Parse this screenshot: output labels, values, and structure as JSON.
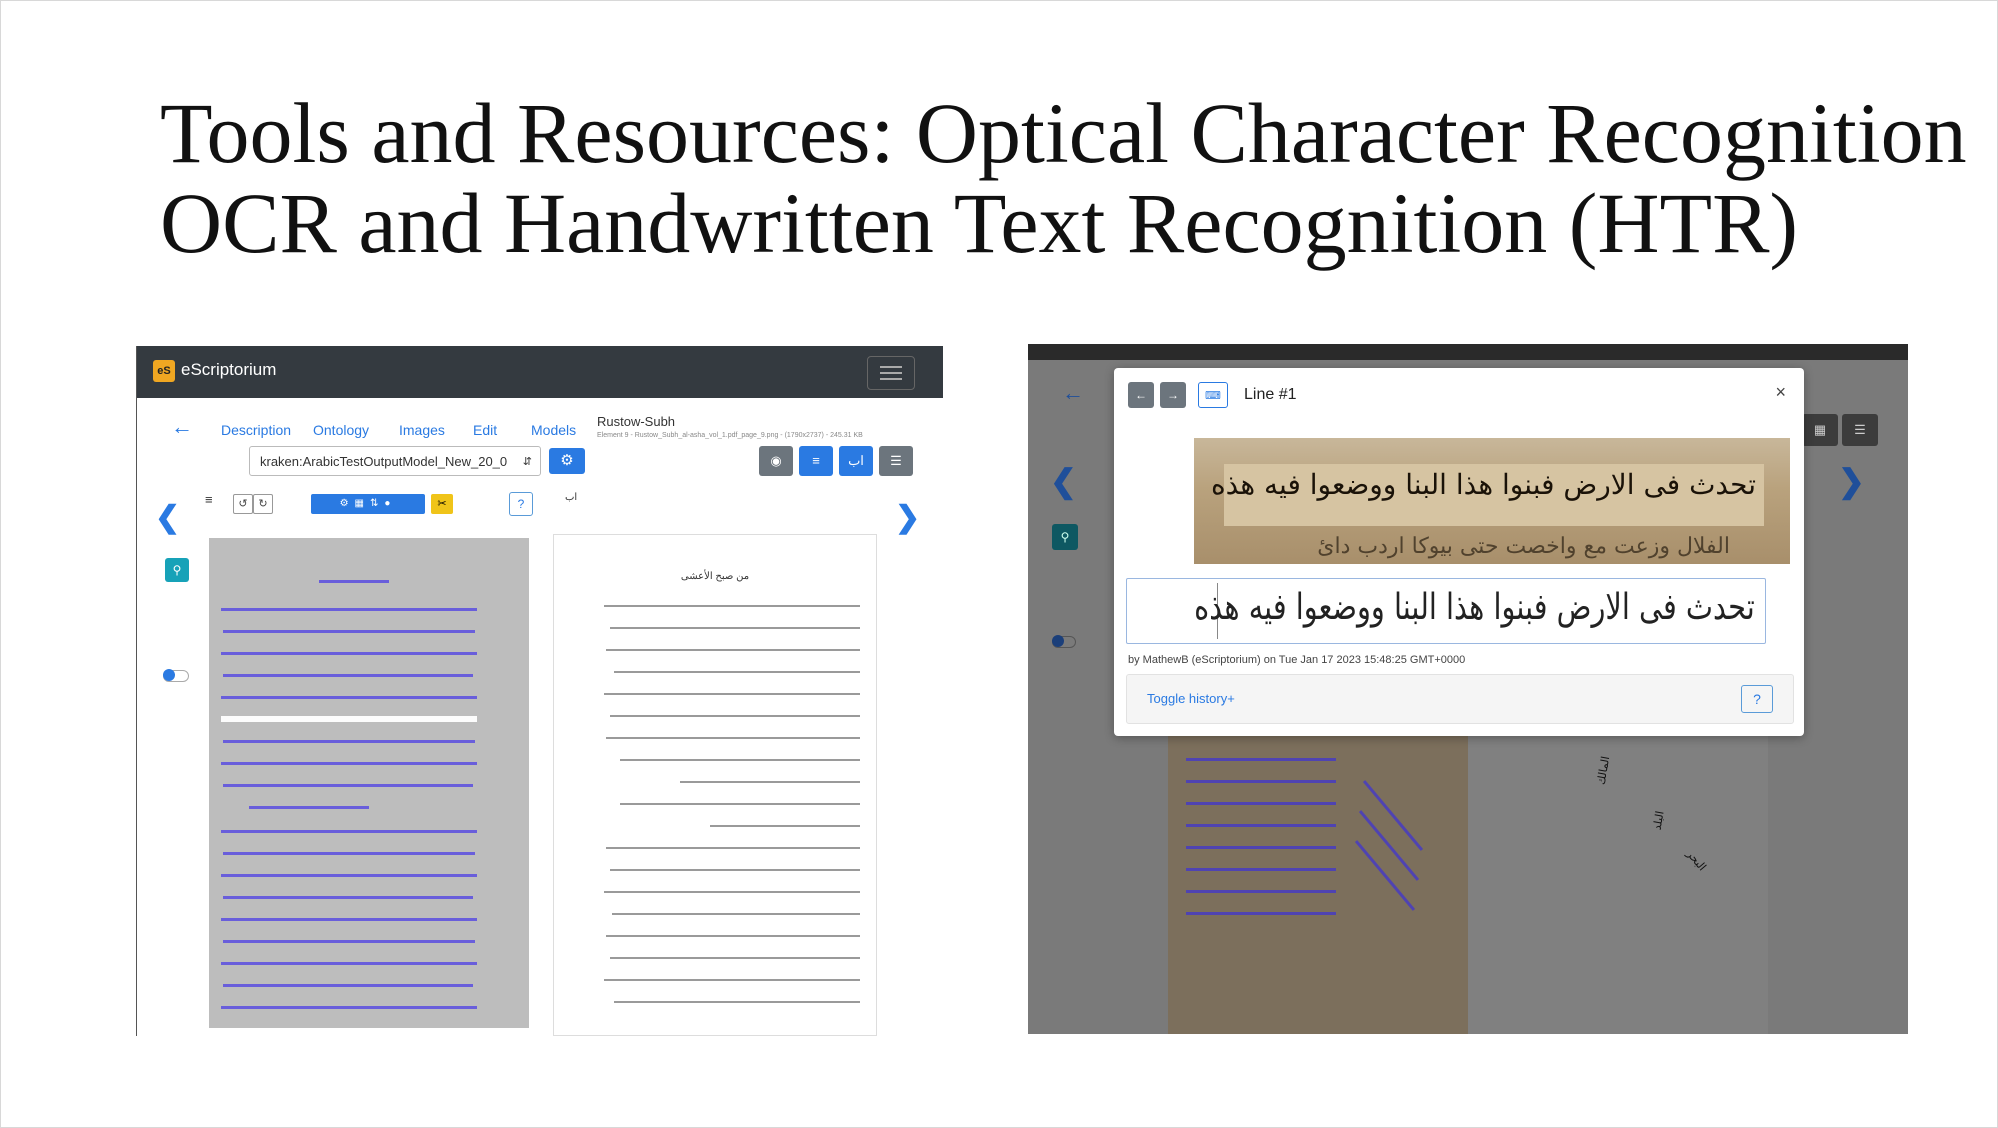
{
  "slide": {
    "title_line1": "Tools and Resources: Optical Character Recognition",
    "title_line2": "OCR and Handwritten Text Recognition (HTR)"
  },
  "left_app": {
    "brand": "eScriptorium",
    "brand_icon": "eS",
    "tabs": [
      "Description",
      "Ontology",
      "Images",
      "Edit",
      "Models"
    ],
    "document_name": "Rustow-Subh",
    "document_meta": "Element 9 - Rustow_Subh_al-asha_vol_1.pdf_page_9.png - (1790x2737) - 245.31 KB",
    "model_select": "kraken:ArabicTestOutputModel_New_20_0",
    "help_label": "?",
    "text_panel_heading": "من صبح الأعشى",
    "colors": {
      "navbar": "#343a40",
      "accent": "#2a7ae2",
      "line_overlay": "#5a4ee0"
    }
  },
  "right_app": {
    "modal": {
      "title": "Line #1",
      "line_image_text": "تحدث فى الارض فبنوا هذا البنا ووضعوا فيه هذه",
      "line_image_text_below": "الفلال وزعت مع واخصت حتى بيوكا اردب دائ",
      "transcription": "تحدث فى الارض فبنوا هذا البنا ووضعوا فيه هذه",
      "meta": "by MathewB (eScriptorium) on Tue Jan 17 2023 15:48:25 GMT+0000",
      "toggle_history": "Toggle history+",
      "help_label": "?",
      "close_label": "×"
    },
    "colors": {
      "overlay": "#7a7a7a",
      "accent": "#2a7ae2"
    }
  }
}
